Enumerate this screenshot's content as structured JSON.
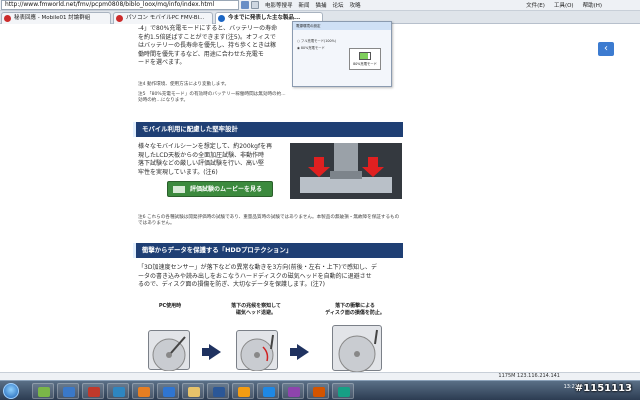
{
  "browser": {
    "url": "http://www.fmworld.net/fmv/pcpm0808/biblo_loox/mq/info/index.html",
    "menu": [
      "电影等搜寻",
      "新闻",
      "猫捕",
      "论坛",
      "攻略"
    ],
    "right_menu": [
      "文件(E)",
      "工具(O)",
      "帮助(H)"
    ],
    "tabs": [
      {
        "label": "秘表回應 - Mobile01 討論群組",
        "fav": "#cc2b2b"
      },
      {
        "label": "パソコン モバイルPC FMV-BI...",
        "fav": "#cc2b2b"
      },
      {
        "label": "今までに発表した主な製品...",
        "fav": "#1c66c4",
        "active": true
      }
    ]
  },
  "page": {
    "intro_lines": [
      "-4」で80%充電モードにすると、バッテリーの寿命",
      "を約1.5倍延ばすことができます(注5)。オフィスで",
      "はバッテリーの長寿命を優先し、持ち歩くときは稼",
      "働時間を優先するなど、用途に合わせた充電モ",
      "ードを選べます。"
    ],
    "notes_top": [
      "注4 動作環境、使用方法により変動します。",
      "注5 「80%充電モード」の有効時のバッテリー稼働時間は無効時の約...",
      "効時の約…になります。"
    ],
    "dialog": {
      "title": "電源環境の設定",
      "opt1": "○ フル充電モード(100%)",
      "opt2": "◉ 80%充電モード",
      "battery": "80%充電モード"
    },
    "section1": "モバイル利用に配慮した堅牢設計",
    "robust_lines": [
      "様々なモバイルシーンを想定して、約200kgfを再",
      "現したLCD天板からの全面加圧試験、非動作時",
      "落下試験などの厳しい評価試験を行い、高い堅",
      "牢性を実現しています。(注6)"
    ],
    "movie_button": "評価試験のムービーを見る",
    "note6": "注6 これらの各種試験は開発評価時の試験であり、重量品質時の試験ではありません。本製品の無破損・無故障を保証するものではありません。",
    "section2": "衝撃からデータを保護する「HDDプロテクション」",
    "hdd_lines": [
      "「3D加速度センサー」が落下などの異常な動きを3方向(前後・左右・上下)で感知し、デ",
      "ータの書き込みや読み出しをおこなうハードディスクの磁気ヘッドを自動的に退避させ",
      "るので、ディスク面の損傷を防ぎ、大切なデータを保護します。(注7)"
    ],
    "stages": [
      {
        "label": "PC使用時"
      },
      {
        "label": "落下の兆候を察知して\n磁気ヘッド退避。"
      },
      {
        "label": "落下の衝撃による\nディスク面の損傷を防止。"
      }
    ]
  },
  "status": {
    "net": "1175M 123.116.214.141"
  },
  "taskbar": {
    "clock_time": "13:22",
    "watermark": "#1151113"
  },
  "colors": {
    "section_bg": "#1f3f74",
    "movie_btn": "#3c8a3e",
    "arrow": "#1f3260"
  }
}
